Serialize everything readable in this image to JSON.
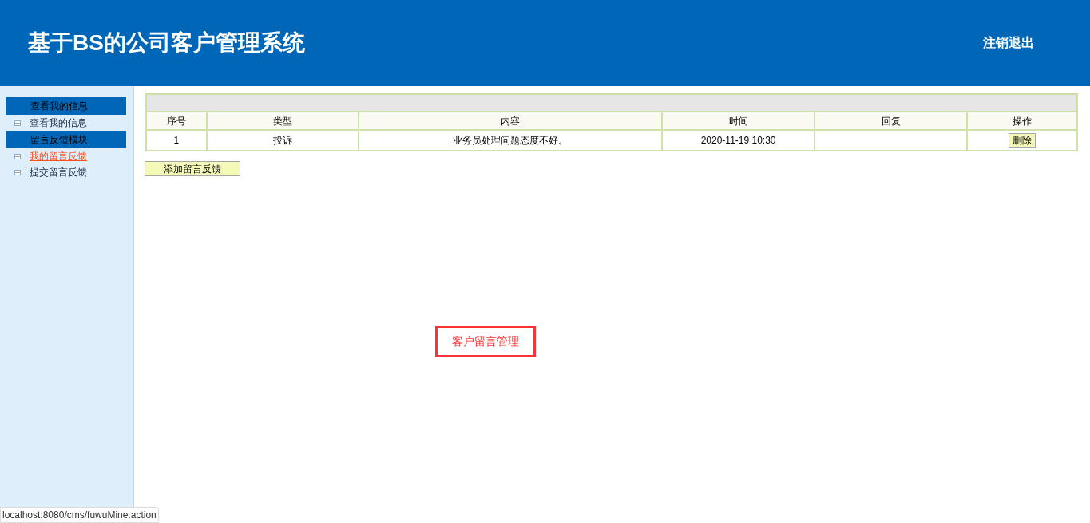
{
  "header": {
    "title": "基于BS的公司客户管理系统",
    "logout": "注销退出"
  },
  "sidebar": {
    "sections": [
      {
        "title": "查看我的信息",
        "items": [
          {
            "label": "查看我的信息",
            "selected": false
          }
        ]
      },
      {
        "title": "留言反馈模块",
        "items": [
          {
            "label": "我的留言反馈",
            "selected": true
          },
          {
            "label": "提交留言反馈",
            "selected": false
          }
        ]
      }
    ]
  },
  "table": {
    "columns": [
      "序号",
      "类型",
      "内容",
      "时间",
      "回复",
      "操作"
    ],
    "rows": [
      {
        "cells": [
          "1",
          "投诉",
          "业务员处理问题态度不好。",
          "2020-11-19 10:30",
          ""
        ],
        "action": "删除"
      }
    ]
  },
  "add_button": "添加留言反馈",
  "annotation": "客户留言管理",
  "status_bar": "localhost:8080/cms/fuwuMine.action"
}
